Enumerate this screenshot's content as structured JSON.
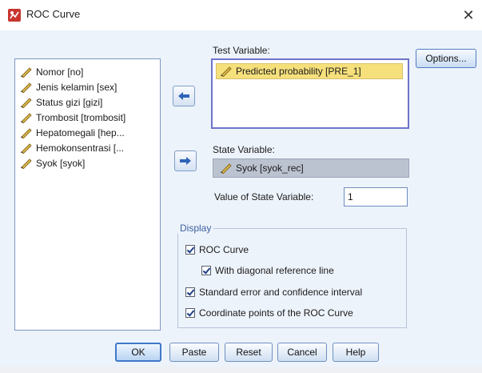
{
  "window": {
    "title": "ROC Curve",
    "close_label": "✕"
  },
  "colors": {
    "client_bg": "#edf3fb",
    "accent_border": "#6e74c8",
    "selected_var_bg": "#f6e07c",
    "state_var_bg": "#bcc3d0",
    "group_label": "#3b5fa0"
  },
  "source_list": {
    "items": [
      {
        "label": "Nomor [no]",
        "icon": "scale-pencil-icon"
      },
      {
        "label": "Jenis kelamin [sex]",
        "icon": "scale-pencil-icon"
      },
      {
        "label": "Status gizi [gizi]",
        "icon": "scale-pencil-icon"
      },
      {
        "label": "Trombosit [trombosit]",
        "icon": "scale-pencil-icon"
      },
      {
        "label": "Hepatomegali [hep...",
        "icon": "scale-pencil-icon"
      },
      {
        "label": "Hemokonsentrasi [...",
        "icon": "scale-pencil-icon"
      },
      {
        "label": "Syok [syok]",
        "icon": "scale-pencil-icon"
      }
    ]
  },
  "test_variable": {
    "label": "Test Variable:",
    "selected": "Predicted probability [PRE_1]"
  },
  "state_variable": {
    "label": "State Variable:",
    "selected": "Syok [syok_rec]"
  },
  "value_of_state": {
    "label": "Value of State Variable:",
    "value": "1"
  },
  "buttons": {
    "options": "Options...",
    "ok": "OK",
    "paste": "Paste",
    "reset": "Reset",
    "cancel": "Cancel",
    "help": "Help"
  },
  "display": {
    "legend": "Display",
    "roc_curve": {
      "label": "ROC Curve",
      "checked": true
    },
    "diagonal_line": {
      "label": "With diagonal reference line",
      "checked": true
    },
    "std_error": {
      "label": "Standard error and confidence interval",
      "checked": true
    },
    "coordinate_points": {
      "label": "Coordinate points of the ROC Curve",
      "checked": true
    }
  }
}
